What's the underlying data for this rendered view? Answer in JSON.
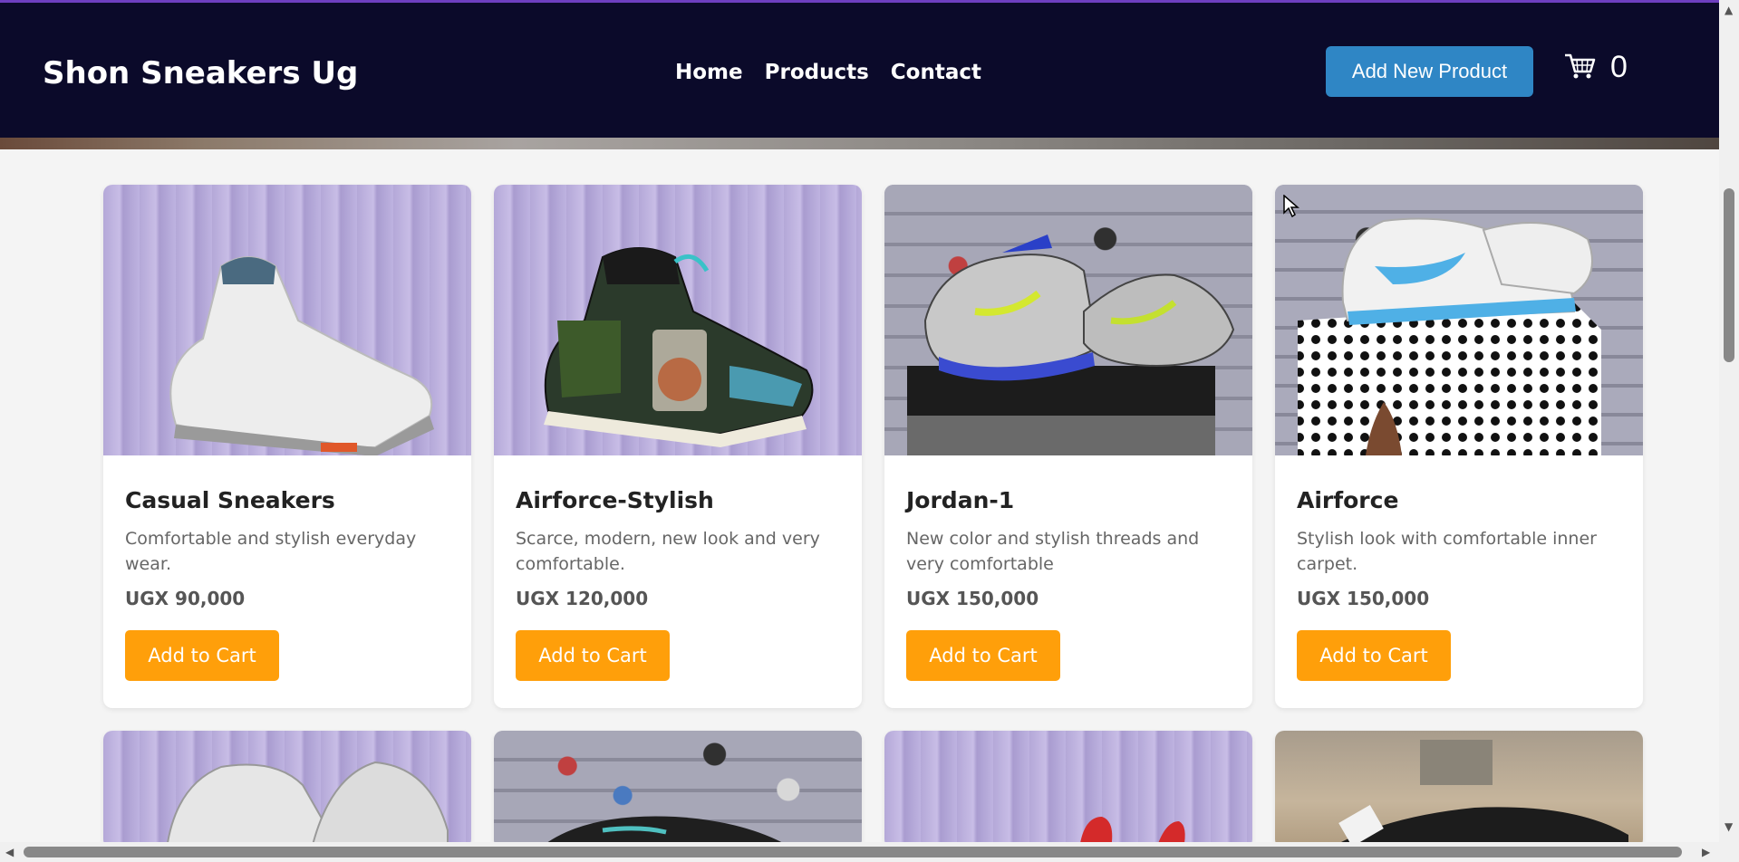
{
  "navbar": {
    "brand": "Shon Sneakers Ug",
    "links": [
      "Home",
      "Products",
      "Contact"
    ],
    "add_product_label": "Add New Product",
    "cart_count": "0",
    "cart_icon": "cart-icon"
  },
  "products": [
    {
      "title": "Casual Sneakers",
      "description": "Comfortable and stylish everyday wear.",
      "price": "UGX 90,000",
      "button": "Add to Cart"
    },
    {
      "title": "Airforce-Stylish",
      "description": "Scarce, modern, new look and very comfortable.",
      "price": "UGX 120,000",
      "button": "Add to Cart"
    },
    {
      "title": "Jordan-1",
      "description": "New color and stylish threads and very comfortable",
      "price": "UGX 150,000",
      "button": "Add to Cart"
    },
    {
      "title": "Airforce",
      "description": "Stylish look with comfortable inner carpet.",
      "price": "UGX 150,000",
      "button": "Add to Cart"
    }
  ],
  "colors": {
    "navbar_bg": "#0b0a2a",
    "accent_button": "#2f86c5",
    "cart_button": "#ff9f0a",
    "top_line": "#6e3fc0"
  }
}
